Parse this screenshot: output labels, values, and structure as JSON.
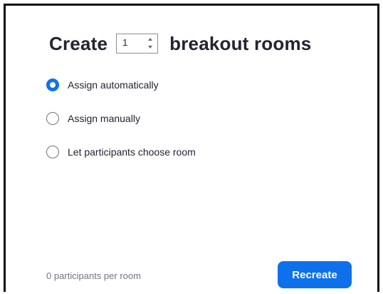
{
  "title": {
    "prefix": "Create",
    "suffix": "breakout rooms"
  },
  "room_count": {
    "value": "1"
  },
  "options": [
    {
      "label": "Assign automatically",
      "checked": true
    },
    {
      "label": "Assign manually",
      "checked": false
    },
    {
      "label": "Let participants choose room",
      "checked": false
    }
  ],
  "footer": {
    "participants_text": "0 participants per room",
    "recreate_label": "Recreate"
  },
  "colors": {
    "accent": "#0e71eb",
    "text": "#232333",
    "muted": "#747487"
  }
}
